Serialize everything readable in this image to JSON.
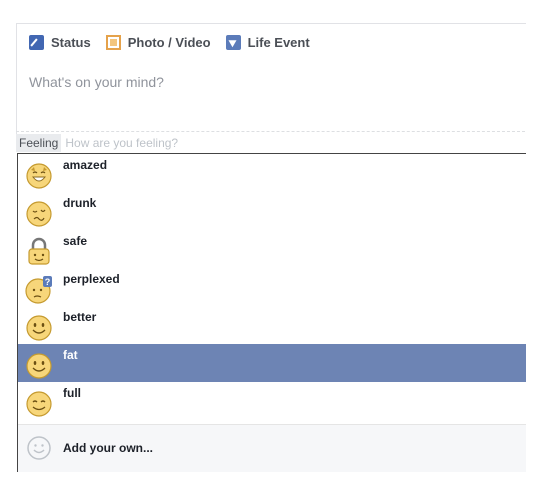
{
  "composer": {
    "tabs": [
      {
        "label": "Status",
        "icon": "pencil-icon"
      },
      {
        "label": "Photo / Video",
        "icon": "photo-icon"
      },
      {
        "label": "Life Event",
        "icon": "flag-icon"
      }
    ],
    "placeholder": "What's on your mind?"
  },
  "feeling": {
    "tag": "Feeling",
    "placeholder": "How are you feeling?"
  },
  "dropdown": {
    "items": [
      {
        "label": "amazed",
        "icon": "amazed-emoji-icon"
      },
      {
        "label": "drunk",
        "icon": "drunk-emoji-icon"
      },
      {
        "label": "safe",
        "icon": "padlock-emoji-icon"
      },
      {
        "label": "perplexed",
        "icon": "perplexed-emoji-icon"
      },
      {
        "label": "better",
        "icon": "smile-emoji-icon"
      },
      {
        "label": "fat",
        "icon": "smile-emoji-icon",
        "selected": true
      },
      {
        "label": "full",
        "icon": "content-emoji-icon"
      }
    ],
    "add_own": "Add your own..."
  },
  "colors": {
    "selection": "#6d84b4",
    "emoji_fill": "#f7d67a",
    "emoji_stroke": "#c59a2f"
  }
}
